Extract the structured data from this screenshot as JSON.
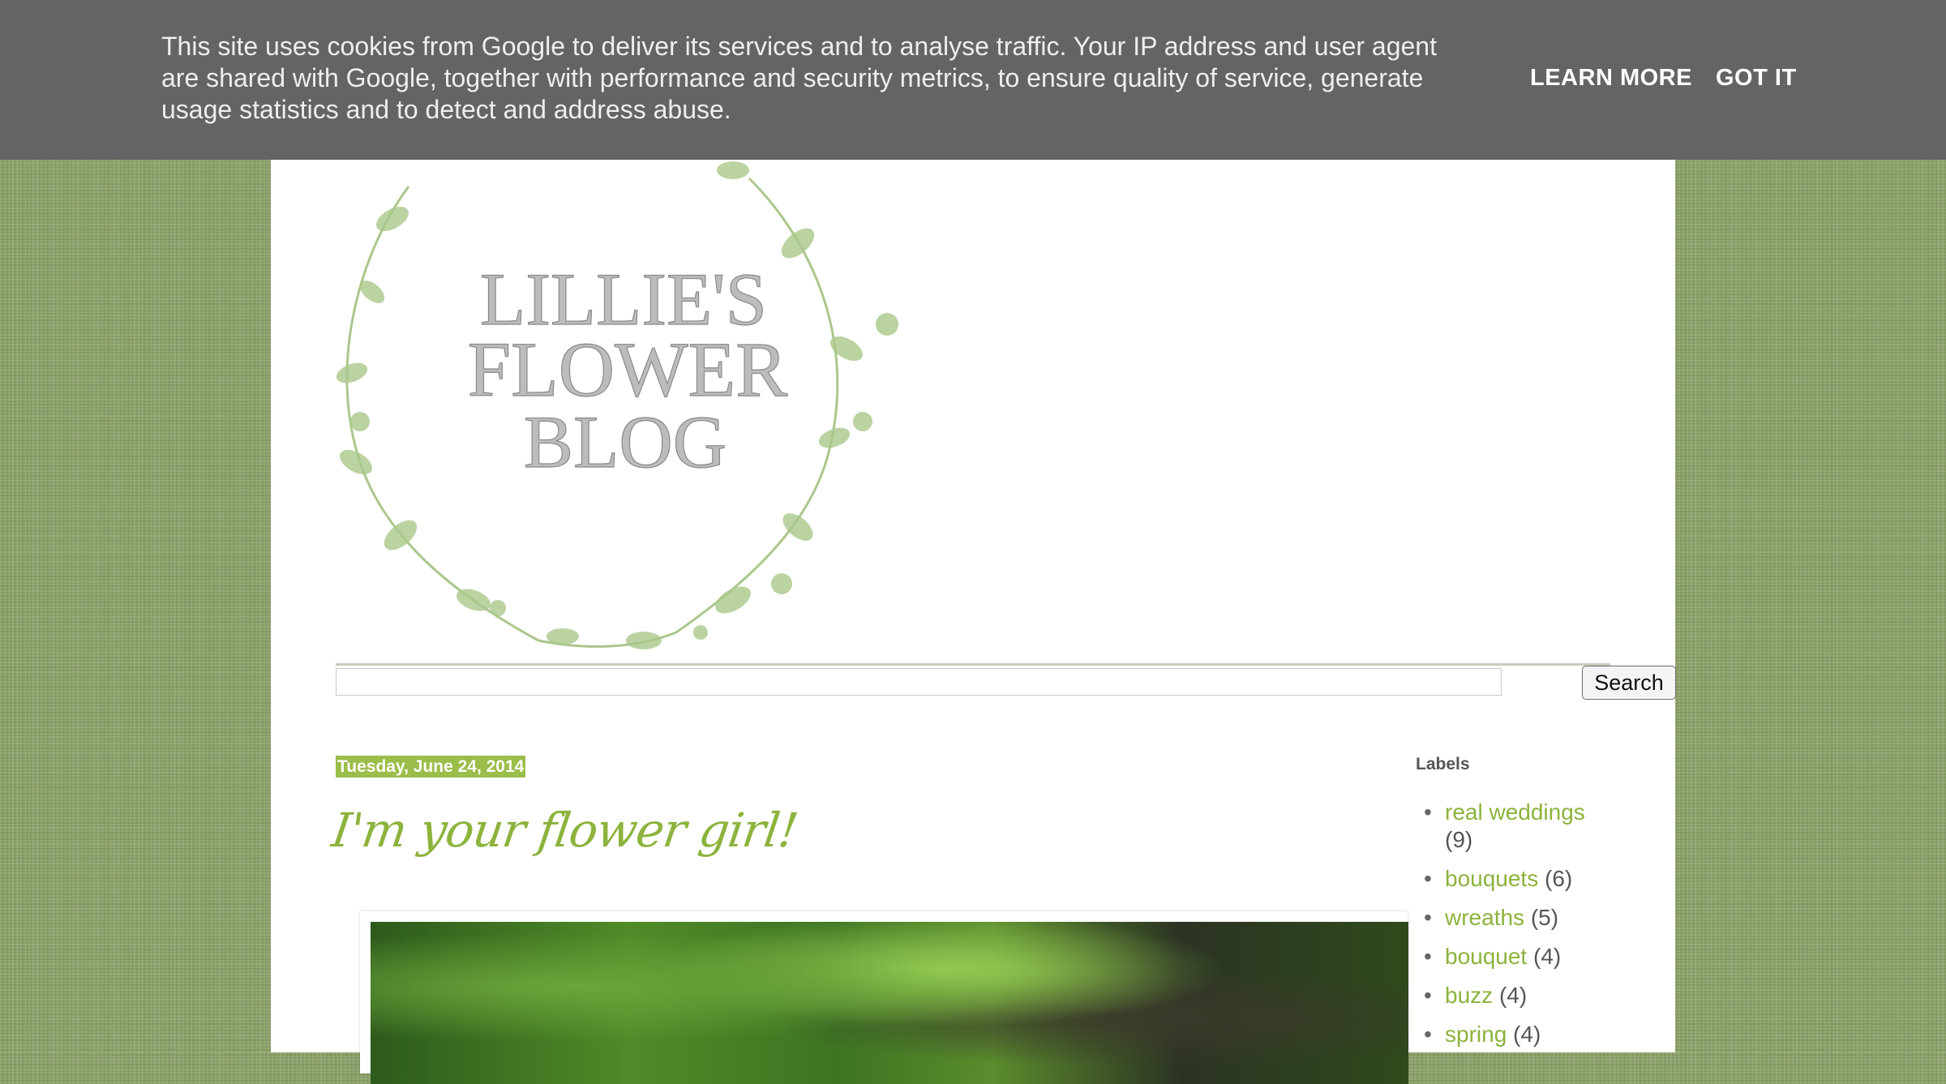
{
  "cookie_bar": {
    "text": "This site uses cookies from Google to deliver its services and to analyse traffic. Your IP address and user agent are shared with Google, together with performance and security metrics, to ensure quality of service, generate usage statistics and to detect and address abuse.",
    "learn_more": "LEARN MORE",
    "got_it": "GOT IT"
  },
  "header": {
    "logo_lines": [
      "LILLIE'S",
      "FLOWER",
      "BLOG"
    ]
  },
  "search": {
    "button_label": "Search",
    "value": ""
  },
  "post": {
    "date": "Tuesday, June 24, 2014",
    "title": "I'm your flower girl!"
  },
  "sidebar": {
    "labels_title": "Labels",
    "labels": [
      {
        "name": "real weddings",
        "count": "(9)"
      },
      {
        "name": "bouquets",
        "count": "(6)"
      },
      {
        "name": "wreaths",
        "count": "(5)"
      },
      {
        "name": "bouquet",
        "count": "(4)"
      },
      {
        "name": "buzz",
        "count": "(4)"
      },
      {
        "name": "spring",
        "count": "(4)"
      }
    ]
  },
  "colors": {
    "accent_green": "#8cb33c",
    "date_bg": "#9bbd4a",
    "cookie_bg": "#646464",
    "background_linen": "#8fa56a"
  }
}
